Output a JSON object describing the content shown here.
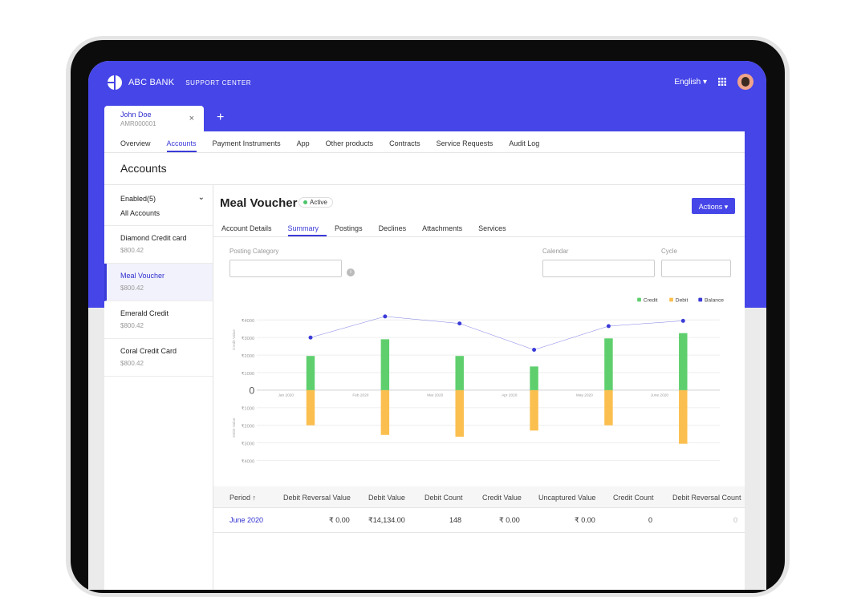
{
  "header": {
    "brand": "ABC BANK",
    "subtitle": "SUPPORT CENTER",
    "language": "English",
    "language_caret": "▾",
    "icons": [
      "apps-grid-icon",
      "avatar"
    ]
  },
  "customer_tab": {
    "name": "John Doe",
    "id": "AMR000001",
    "close": "×",
    "add": "+"
  },
  "nav_tabs": [
    "Overview",
    "Accounts",
    "Payment Instruments",
    "App",
    "Other products",
    "Contracts",
    "Service Requests",
    "Audit Log"
  ],
  "active_nav": "Accounts",
  "page_title": "Accounts",
  "sidebar": {
    "filter": "Enabled(5)",
    "filter_chevron": "⌄",
    "all": "All Accounts",
    "items": [
      {
        "name": "Diamond Credit card",
        "amount": "$800.42"
      },
      {
        "name": "Meal Voucher",
        "amount": "$800.42",
        "selected": true
      },
      {
        "name": "Emerald Credit",
        "amount": "$800.42"
      },
      {
        "name": "Coral Credit Card",
        "amount": "$800.42"
      }
    ]
  },
  "account": {
    "title": "Meal Voucher",
    "status": "Active",
    "actions_label": "Actions ▾",
    "subtabs": [
      "Account Details",
      "Summary",
      "Postings",
      "Declines",
      "Attachments",
      "Services"
    ],
    "active_subtab": "Summary"
  },
  "filters": {
    "posting_category_label": "Posting Category",
    "calendar_label": "Calendar",
    "cycle_label": "Cycle",
    "info_icon": "i"
  },
  "chart_data": {
    "type": "bar",
    "categories": [
      "Jan 2020",
      "Feb 2020",
      "Mar 2020",
      "Apr 2020",
      "May 2020",
      "June 2020"
    ],
    "series": [
      {
        "name": "Credit",
        "color": "#5fcf6e",
        "values": [
          1950,
          2900,
          1950,
          1350,
          2950,
          3250
        ]
      },
      {
        "name": "Debit",
        "color": "#fbbf4f",
        "values": [
          -2000,
          -2550,
          -2650,
          -2300,
          -2000,
          -3050
        ]
      },
      {
        "name": "Balance",
        "color": "#3b3bd8",
        "type": "line",
        "values": [
          3000,
          4200,
          3800,
          2300,
          3650,
          3950
        ]
      }
    ],
    "yticks_credit": [
      "₹4000",
      "₹3000",
      "₹2000",
      "₹1000"
    ],
    "yticks_debit": [
      "₹1000",
      "₹2000",
      "₹3000",
      "₹4000"
    ],
    "zero_label": "0",
    "ylabel_top": "Credit Value",
    "ylabel_bottom": "Debit Value",
    "ylim": [
      -4000,
      4000
    ],
    "legend_position": "top-right",
    "grid": true
  },
  "table": {
    "headers": [
      "Period ↑",
      "Debit Reversal Value",
      "Debit Value",
      "Debit Count",
      "Credit Value",
      "Uncaptured Value",
      "Credit Count",
      "Debit Reversal Count"
    ],
    "rows": [
      [
        "June 2020",
        "₹ 0.00",
        "₹14,134.00",
        "148",
        "₹ 0.00",
        "₹ 0.00",
        "0",
        "0"
      ]
    ]
  }
}
